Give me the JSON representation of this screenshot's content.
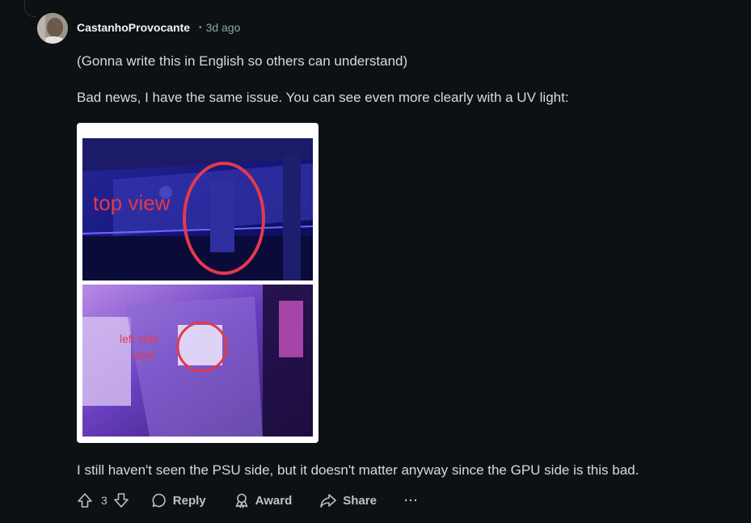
{
  "comment": {
    "author": "CastanhoProvocante",
    "separator": "•",
    "time_ago": "3d ago",
    "paragraphs": [
      "(Gonna write this in English so others can understand)",
      "Bad news, I have the same issue. You can see even more clearly with a UV light:",
      "I still haven't seen the PSU side, but it doesn't matter anyway since the GPU side is this bad."
    ],
    "image": {
      "top_annotation": "top view",
      "bottom_annotation_line1": "left side",
      "bottom_annotation_line2": "view"
    }
  },
  "actions": {
    "vote_count": "3",
    "reply_label": "Reply",
    "award_label": "Award",
    "share_label": "Share",
    "more_label": "···"
  },
  "colors": {
    "background": "#0e1113",
    "text": "#d7dadc",
    "meta": "#8ba2ad",
    "annotation_red": "#e23a4a"
  }
}
